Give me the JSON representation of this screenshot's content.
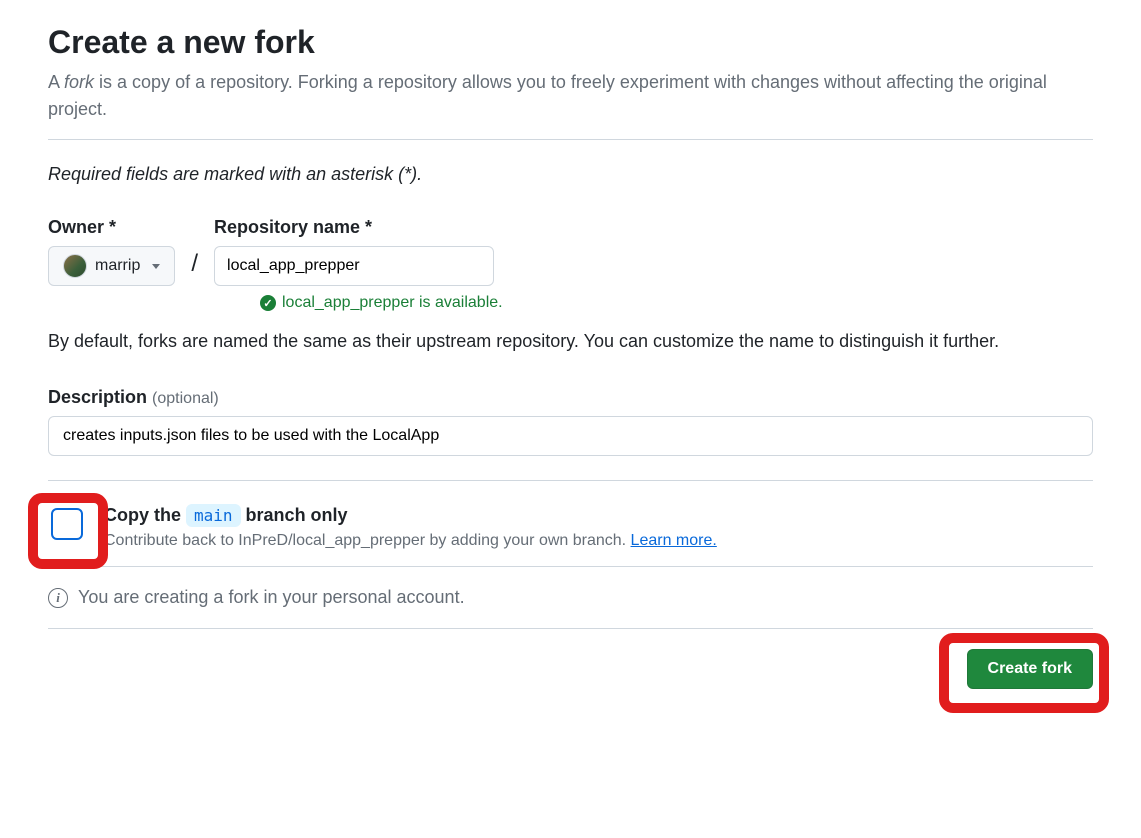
{
  "header": {
    "title": "Create a new fork",
    "subtitle_prefix": "A ",
    "subtitle_emphasis": "fork",
    "subtitle_suffix": " is a copy of a repository. Forking a repository allows you to freely experiment with changes without affecting the original project."
  },
  "required_note": "Required fields are marked with an asterisk (*).",
  "owner": {
    "label": "Owner *",
    "value": "marrip"
  },
  "repo": {
    "label": "Repository name *",
    "value": "local_app_prepper"
  },
  "availability": "local_app_prepper is available.",
  "name_helper": "By default, forks are named the same as their upstream repository. You can customize the name to distinguish it further.",
  "description": {
    "label": "Description",
    "optional": "(optional)",
    "value": "creates inputs.json files to be used with the LocalApp"
  },
  "copy_branch": {
    "label_prefix": "Copy the ",
    "branch": "main",
    "label_suffix": " branch only",
    "help_text": "Contribute back to InPreD/local_app_prepper by adding your own branch. ",
    "learn_more": "Learn more."
  },
  "info_text": "You are creating a fork in your personal account.",
  "create_button": "Create fork"
}
